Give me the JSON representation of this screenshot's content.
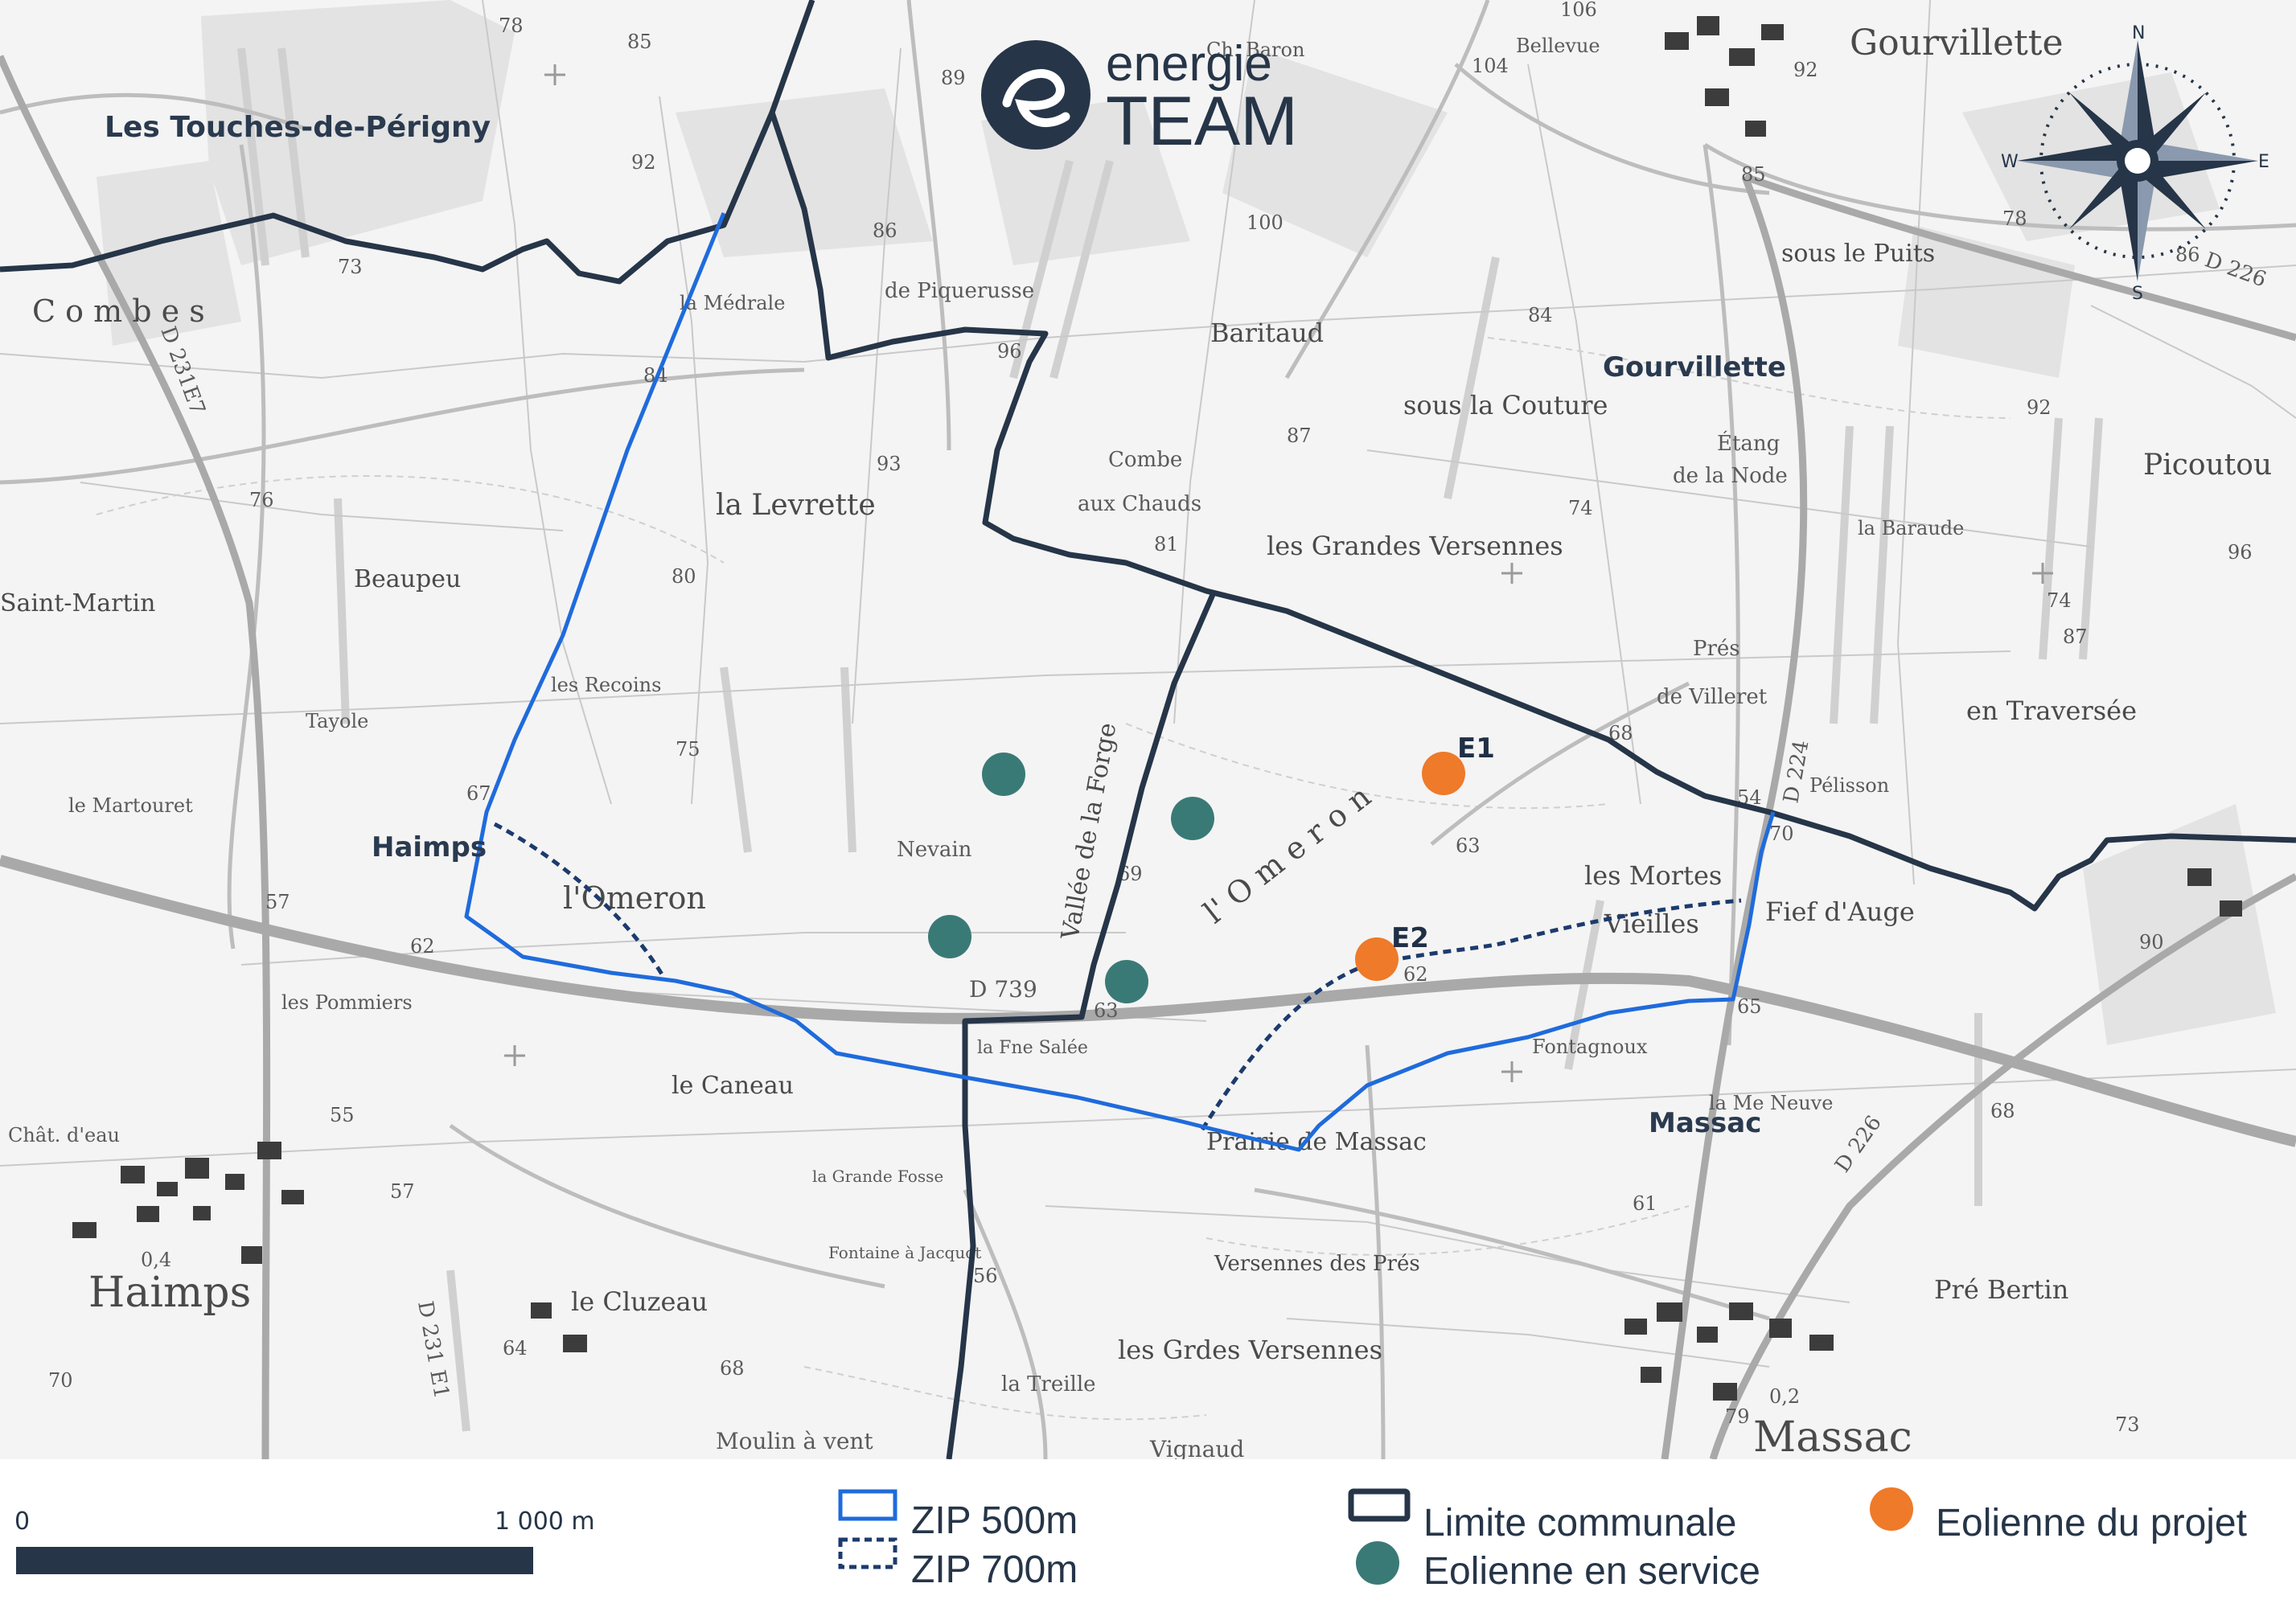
{
  "logo": {
    "line1": "energie",
    "line2": "TEAM"
  },
  "compass": {
    "n": "N",
    "s": "S",
    "e": "E",
    "w": "W"
  },
  "towns": {
    "touches": "Les Touches-de-Périgny",
    "haimps": "Haimps",
    "gourvillette": "Gourvillette",
    "massac": "Massac"
  },
  "places": {
    "gourvillette_big": "Gourvillette",
    "haimps_big": "Haimps",
    "massac_big": "Massac",
    "combes": "C o m b e s",
    "levrette": "la Levrette",
    "omeron1": "l'Omeron",
    "omeron2": "l' O m e r o n",
    "baritaud": "Baritaud",
    "couture": "sous la Couture",
    "grandes_versennes": "les Grandes Versennes",
    "mortes_vieilles1": "les Mortes",
    "mortes_vieilles2": "Vieilles",
    "fief_auge": "Fief d'Auge",
    "en_traversee": "en Traversée",
    "canneau": "le Caneau",
    "beaupeu": "Beaupeu",
    "saint_martin": "Saint-Martin",
    "picoutou": "Picoutou",
    "pre_bertin": "Pré Bertin",
    "cluzeau": "le Cluzeau",
    "sous_puits": "sous le Puits",
    "versennes_pres": "Versennes des Prés",
    "grds_versennes": "les Grdes Versennes",
    "prairie": "Prairie de Massac",
    "nevain": "Nevain",
    "vallee_forge": "Vallée de la Forge",
    "combe_chauds1": "Combe",
    "combe_chauds2": "aux Chauds",
    "medrale": "la Médrale",
    "piquerusse": "de Piquerusse",
    "recoins": "les Recoins",
    "tayole": "Tayole",
    "martouret": "le Martouret",
    "pommiers": "les Pommiers",
    "fontagnoux": "Fontagnoux",
    "pres_villeret1": "Prés",
    "pres_villeret2": "de Villeret",
    "pelisson": "Pélisson",
    "baraude": "la Baraude",
    "etang_node1": "Étang",
    "etang_node2": "de la Node",
    "treille": "la Treille",
    "vignaud": "Vignaud",
    "moulin": "Moulin à vent",
    "grande_fosse": "la Grande Fosse",
    "fontaine_jacquot": "Fontaine à Jacquot",
    "salee": "la Fne Salée",
    "m_neuve": "la Me Neuve",
    "chateau_eau": "Chât. d'eau",
    "bellevue": "Bellevue",
    "baron": "Ch. Baron",
    "route_d739": "D 739",
    "route_d224": "D 224",
    "route_d226": "D 226",
    "route_d226b": "D 226",
    "route_d231": "D 231E7",
    "route_d231b": "D 231 E1"
  },
  "spot_heights": [
    "78",
    "85",
    "89",
    "92",
    "73",
    "86",
    "100",
    "104",
    "106",
    "92",
    "85",
    "84",
    "96",
    "93",
    "87",
    "84",
    "76",
    "80",
    "75",
    "67",
    "57",
    "62",
    "55",
    "57",
    "81",
    "74",
    "68",
    "70",
    "65",
    "68",
    "63",
    "62",
    "63",
    "69",
    "56",
    "64",
    "68",
    "70",
    "79",
    "73",
    "92",
    "96",
    "87",
    "74",
    "78",
    "86",
    "90",
    "61",
    "54",
    "0,4",
    "0,2"
  ],
  "turbines_project": [
    {
      "id": "E1",
      "label": "E1"
    },
    {
      "id": "E2",
      "label": "E2"
    }
  ],
  "turbines_service_count": 4,
  "legend": {
    "scale_start": "0",
    "scale_end": "1 000 m",
    "zip500": "ZIP 500m",
    "zip700": "ZIP 700m",
    "limite": "Limite communale",
    "service": "Eolienne en service",
    "projet": "Eolienne du projet"
  },
  "colors": {
    "zip500": "#1f6bdc",
    "zip700": "#1c3b6e",
    "limite": "#263548",
    "service": "#3a7a76",
    "projet": "#ee7a2a",
    "road": "#a9a9a9"
  }
}
